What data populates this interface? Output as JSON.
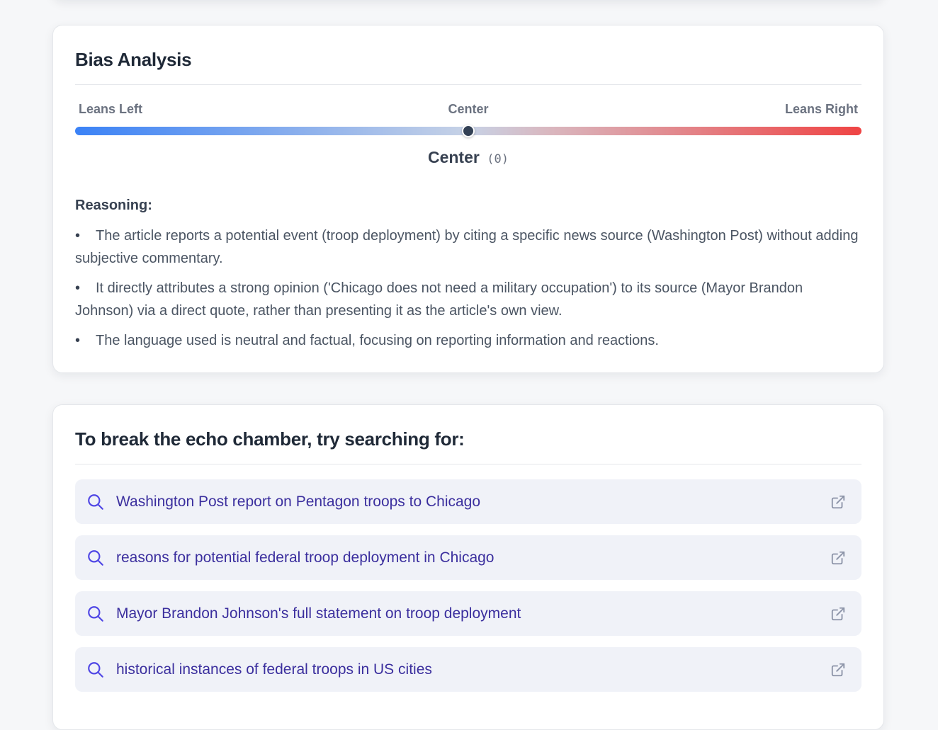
{
  "bias_analysis": {
    "title": "Bias Analysis",
    "scale": {
      "left_label": "Leans Left",
      "center_label": "Center",
      "right_label": "Leans Right",
      "position_fraction": 0.5,
      "gradient_left_color": "#3b82f6",
      "gradient_right_color": "#ef4444"
    },
    "result": {
      "label": "Center",
      "score": "(0)"
    },
    "reasoning": {
      "heading": "Reasoning:",
      "items": [
        "The article reports a potential event (troop deployment) by citing a specific news source (Washington Post) without adding subjective commentary.",
        "It directly attributes a strong opinion ('Chicago does not need a military occupation') to its source (Mayor Brandon Johnson) via a direct quote, rather than presenting it as the article's own view.",
        "The language used is neutral and factual, focusing on reporting information and reactions."
      ]
    }
  },
  "echo_chamber": {
    "title": "To break the echo chamber, try searching for:",
    "searches": [
      {
        "query": "Washington Post report on Pentagon troops to Chicago",
        "icon": "search-icon",
        "action_icon": "external-link-icon"
      },
      {
        "query": "reasons for potential federal troop deployment in Chicago",
        "icon": "search-icon",
        "action_icon": "external-link-icon"
      },
      {
        "query": "Mayor Brandon Johnson's full statement on troop deployment",
        "icon": "search-icon",
        "action_icon": "external-link-icon"
      },
      {
        "query": "historical instances of federal troops in US cities",
        "icon": "search-icon",
        "action_icon": "external-link-icon"
      }
    ],
    "accent_color": "#4f46e5"
  }
}
